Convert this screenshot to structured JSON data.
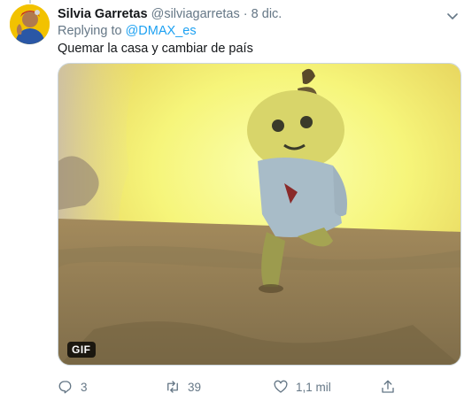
{
  "tweet": {
    "author_name": "Silvia Garretas",
    "author_handle": "@silviagarretas",
    "separator": "·",
    "date": "8 dic.",
    "reply_prefix": "Replying to",
    "reply_to": "@DMAX_es",
    "text": "Quemar la casa y cambiar de país"
  },
  "media": {
    "badge": "GIF"
  },
  "actions": {
    "replies": "3",
    "retweets": "39",
    "likes": "1,1 mil"
  },
  "icons": {
    "menu": "chevron-down-icon",
    "reply": "reply-icon",
    "retweet": "retweet-icon",
    "like": "heart-icon",
    "share": "share-icon"
  },
  "colors": {
    "text": "#14171a",
    "muted": "#657786",
    "link": "#1da1f2",
    "border": "#ccd6dd"
  }
}
